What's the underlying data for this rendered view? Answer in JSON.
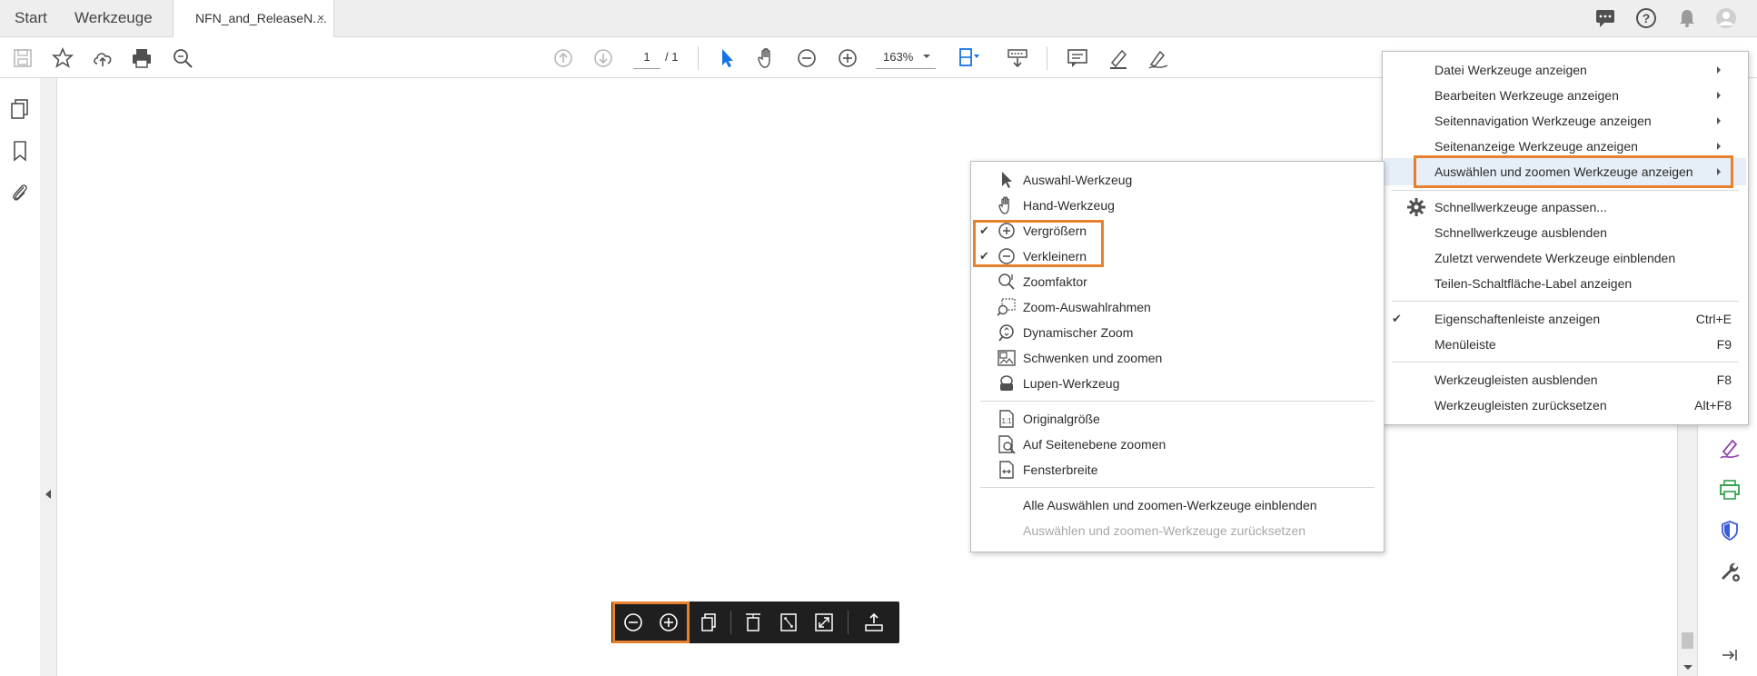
{
  "tabs": {
    "start": "Start",
    "tools": "Werkzeuge",
    "document": "NFN_and_ReleaseN....",
    "close": "×"
  },
  "toolbar": {
    "page_current": "1",
    "page_total": "/ 1",
    "zoom": "163%"
  },
  "main_menu": {
    "items": [
      {
        "label": "Datei Werkzeuge anzeigen",
        "submenu": true
      },
      {
        "label": "Bearbeiten Werkzeuge anzeigen",
        "submenu": true
      },
      {
        "label": "Seitennavigation Werkzeuge anzeigen",
        "submenu": true
      },
      {
        "label": "Seitenanzeige Werkzeuge anzeigen",
        "submenu": true
      },
      {
        "label": "Auswählen und zoomen Werkzeuge anzeigen",
        "submenu": true,
        "highlighted": true
      },
      {
        "label": "Schnellwerkzeuge anpassen..."
      },
      {
        "label": "Schnellwerkzeuge ausblenden"
      },
      {
        "label": "Zuletzt verwendete Werkzeuge einblenden"
      },
      {
        "label": "Teilen-Schaltfläche-Label anzeigen"
      },
      {
        "label": "Eigenschaftenleiste anzeigen",
        "shortcut": "Ctrl+E"
      },
      {
        "label": "Menüleiste",
        "shortcut": "F9",
        "checked": true
      },
      {
        "label": "Werkzeugleisten ausblenden",
        "shortcut": "F8"
      },
      {
        "label": "Werkzeugleisten zurücksetzen",
        "shortcut": "Alt+F8"
      }
    ]
  },
  "sub_menu": {
    "items": [
      {
        "label": "Auswahl-Werkzeug",
        "icon": "arrow-pointer-icon"
      },
      {
        "label": "Hand-Werkzeug",
        "icon": "hand-icon"
      },
      {
        "label": "Vergrößern",
        "icon": "zoom-in-icon",
        "checked": true
      },
      {
        "label": "Verkleinern",
        "icon": "zoom-out-icon",
        "checked": true
      },
      {
        "label": "Zoomfaktor",
        "icon": "zoom-factor-icon"
      },
      {
        "label": "Zoom-Auswahlrahmen",
        "icon": "marquee-zoom-icon"
      },
      {
        "label": "Dynamischer Zoom",
        "icon": "dynamic-zoom-icon"
      },
      {
        "label": "Schwenken und zoomen",
        "icon": "pan-zoom-icon"
      },
      {
        "label": "Lupen-Werkzeug",
        "icon": "loupe-icon"
      },
      {
        "label": "Originalgröße",
        "icon": "actual-size-icon"
      },
      {
        "label": "Auf Seitenebene zoomen",
        "icon": "zoom-page-level-icon"
      },
      {
        "label": "Fensterbreite",
        "icon": "fit-width-icon"
      },
      {
        "label": "Alle Auswählen und zoomen-Werkzeuge einblenden"
      },
      {
        "label": "Auswählen und zoomen-Werkzeuge zurücksetzen",
        "disabled": true
      }
    ]
  },
  "checkmark": "✔",
  "colors": {
    "highlight": "#e8812d",
    "accent_blue": "#1473e6",
    "purple": "#8e44ad",
    "green": "#2e9e49",
    "floatbar_bg": "#1f1f1f"
  }
}
